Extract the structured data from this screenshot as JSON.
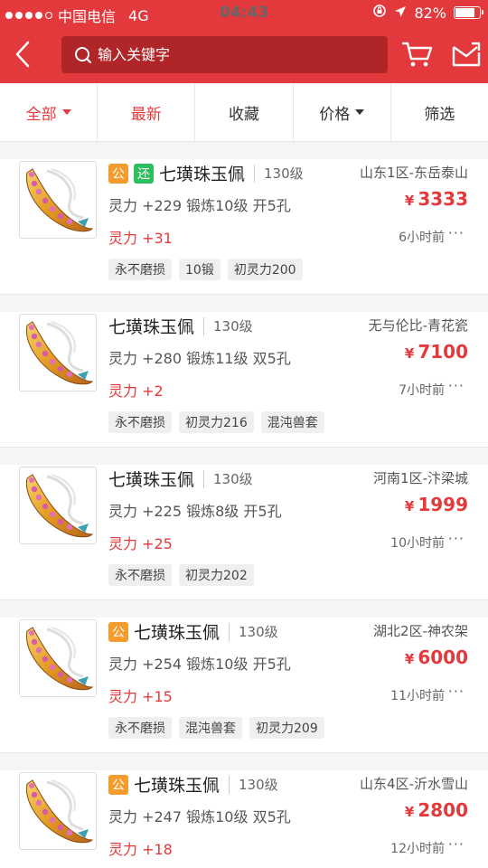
{
  "status_bar": {
    "carrier": "中国电信",
    "network": "4G",
    "time": "04:43",
    "battery": "82%",
    "battery_level": 0.82
  },
  "header": {
    "search_placeholder": "输入关键字",
    "accent_color": "#e4393c"
  },
  "filters": [
    {
      "label": "全部",
      "has_caret": true,
      "active": true
    },
    {
      "label": "最新",
      "has_caret": false,
      "active": true
    },
    {
      "label": "收藏",
      "has_caret": false,
      "active": false
    },
    {
      "label": "价格",
      "has_caret": true,
      "active": false
    },
    {
      "label": "筛选",
      "has_caret": false,
      "active": false
    }
  ],
  "items": [
    {
      "badges": [
        "公",
        "还"
      ],
      "name": "七璜珠玉佩",
      "level": "130级",
      "server": "山东1区-东岳泰山",
      "stats": "灵力 +229 锻炼10级 开5孔",
      "price": "3333",
      "bonus": "灵力 +31",
      "time": "6小时前",
      "tags": [
        "永不磨损",
        "10锻",
        "初灵力200"
      ]
    },
    {
      "badges": [],
      "name": "七璜珠玉佩",
      "level": "130级",
      "server": "无与伦比-青花瓷",
      "stats": "灵力 +280 锻炼11级 双5孔",
      "price": "7100",
      "bonus": "灵力 +2",
      "time": "7小时前",
      "tags": [
        "永不磨损",
        "初灵力216",
        "混沌兽套"
      ]
    },
    {
      "badges": [],
      "name": "七璜珠玉佩",
      "level": "130级",
      "server": "河南1区-汴梁城",
      "stats": "灵力 +225 锻炼8级 开5孔",
      "price": "1999",
      "bonus": "灵力 +25",
      "time": "10小时前",
      "tags": [
        "永不磨损",
        "初灵力202"
      ]
    },
    {
      "badges": [
        "公"
      ],
      "name": "七璜珠玉佩",
      "level": "130级",
      "server": "湖北2区-神农架",
      "stats": "灵力 +254 锻炼10级 开5孔",
      "price": "6000",
      "bonus": "灵力 +15",
      "time": "11小时前",
      "tags": [
        "永不磨损",
        "混沌兽套",
        "初灵力209"
      ]
    },
    {
      "badges": [
        "公"
      ],
      "name": "七璜珠玉佩",
      "level": "130级",
      "server": "山东4区-沂水雪山",
      "stats": "灵力 +247 锻炼10级 双5孔",
      "price": "2800",
      "bonus": "灵力 +18",
      "time": "12小时前",
      "tags": []
    }
  ]
}
